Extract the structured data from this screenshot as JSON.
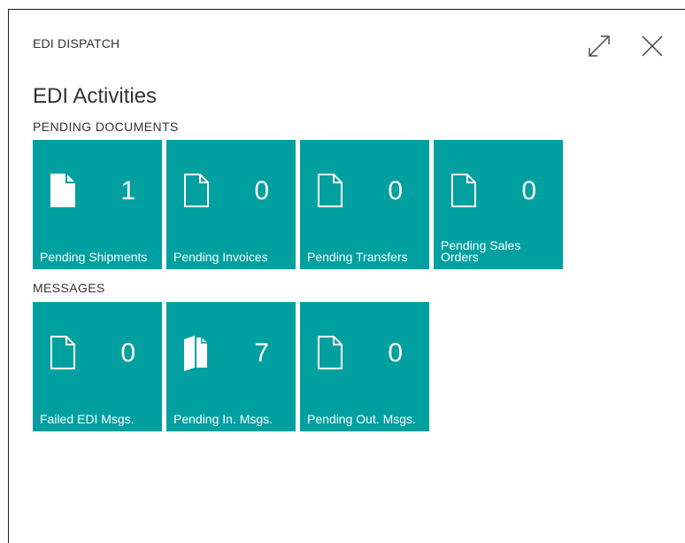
{
  "panel": {
    "title": "EDI DISPATCH"
  },
  "page": {
    "heading": "EDI Activities"
  },
  "sections": {
    "pending_documents": {
      "label": "PENDING DOCUMENTS",
      "tiles": [
        {
          "label": "Pending Shipments",
          "count": "1",
          "icon": "document-filled-icon"
        },
        {
          "label": "Pending Invoices",
          "count": "0",
          "icon": "document-outline-icon"
        },
        {
          "label": "Pending Transfers",
          "count": "0",
          "icon": "document-outline-icon"
        },
        {
          "label": "Pending Sales Orders",
          "count": "0",
          "icon": "document-outline-icon"
        }
      ]
    },
    "messages": {
      "label": "MESSAGES",
      "tiles": [
        {
          "label": "Failed EDI Msgs.",
          "count": "0",
          "icon": "document-outline-icon"
        },
        {
          "label": "Pending In. Msgs.",
          "count": "7",
          "icon": "document-open-icon"
        },
        {
          "label": "Pending Out. Msgs.",
          "count": "0",
          "icon": "document-outline-icon"
        }
      ]
    }
  },
  "colors": {
    "tile_background": "#00a0a0",
    "tile_foreground": "#ffffff",
    "text": "#333333"
  }
}
